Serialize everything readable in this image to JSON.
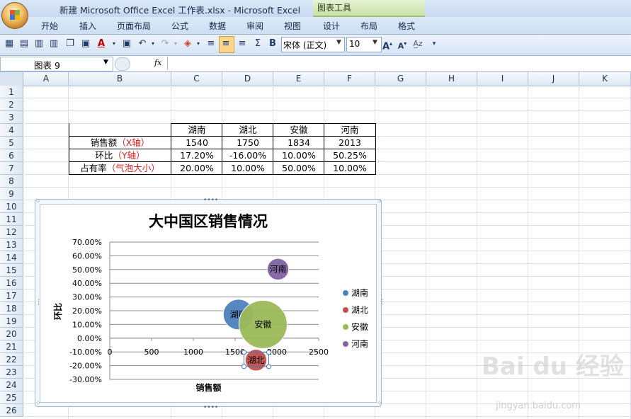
{
  "window": {
    "title": "新建 Microsoft Office Excel 工作表.xlsx - Microsoft Excel",
    "context_tab": "图表工具"
  },
  "ribbon": {
    "tabs": [
      "开始",
      "插入",
      "页面布局",
      "公式",
      "数据",
      "审阅",
      "视图",
      "设计",
      "布局",
      "格式"
    ]
  },
  "toolbar": {
    "font_name": "宋体 (正文)",
    "font_size": "10",
    "bold_label": "B",
    "sigma_label": "Σ"
  },
  "formula_bar": {
    "name_box": "图表 9",
    "fx_label": "fx",
    "content": ""
  },
  "grid": {
    "columns": [
      "A",
      "B",
      "C",
      "D",
      "E",
      "F",
      "G",
      "H",
      "I",
      "J",
      "K"
    ],
    "rows": [
      "1",
      "2",
      "3",
      "4",
      "5",
      "6",
      "7",
      "8",
      "9",
      "10",
      "11",
      "12",
      "13",
      "14",
      "15",
      "16",
      "17",
      "18",
      "19",
      "20",
      "21",
      "22",
      "23",
      "24",
      "25",
      "26"
    ]
  },
  "table": {
    "header": [
      "湖南",
      "湖北",
      "安徽",
      "河南"
    ],
    "rows": [
      {
        "label": "销售额",
        "label_note": "（X轴）",
        "values": [
          "1540",
          "1750",
          "1834",
          "2013"
        ]
      },
      {
        "label": "环比",
        "label_note": "（Y轴）",
        "values": [
          "17.20%",
          "-16.00%",
          "10.00%",
          "50.25%"
        ]
      },
      {
        "label": "占有率",
        "label_note": "（气泡大小）",
        "values": [
          "20.00%",
          "10.00%",
          "50.00%",
          "10.00%"
        ]
      }
    ]
  },
  "chart_data": {
    "type": "bubble",
    "title": "大中国区销售情况",
    "xlabel": "销售额",
    "ylabel": "环比",
    "xlim": [
      0,
      2500
    ],
    "ylim": [
      -0.3,
      0.7
    ],
    "x_ticks": [
      "0",
      "500",
      "1000",
      "1500",
      "2000",
      "2500"
    ],
    "y_ticks": [
      "70.00%",
      "60.00%",
      "50.00%",
      "40.00%",
      "30.00%",
      "20.00%",
      "10.00%",
      "0.00%",
      "-10.00%",
      "-20.00%",
      "-30.00%"
    ],
    "legend_position": "right",
    "series": [
      {
        "name": "湖南",
        "x": 1540,
        "y": 0.172,
        "size": 0.2,
        "color": "#4f81bd",
        "label": "湖南"
      },
      {
        "name": "湖北",
        "x": 1750,
        "y": -0.16,
        "size": 0.1,
        "color": "#c0504d",
        "label": "湖北"
      },
      {
        "name": "安徽",
        "x": 1834,
        "y": 0.1,
        "size": 0.5,
        "color": "#9bbb59",
        "label": "安徽"
      },
      {
        "name": "河南",
        "x": 2013,
        "y": 0.5025,
        "size": 0.1,
        "color": "#8064a2",
        "label": "河南"
      }
    ]
  },
  "watermark": {
    "text": "Bai du 经验",
    "url": "jingyan.baidu.com"
  }
}
